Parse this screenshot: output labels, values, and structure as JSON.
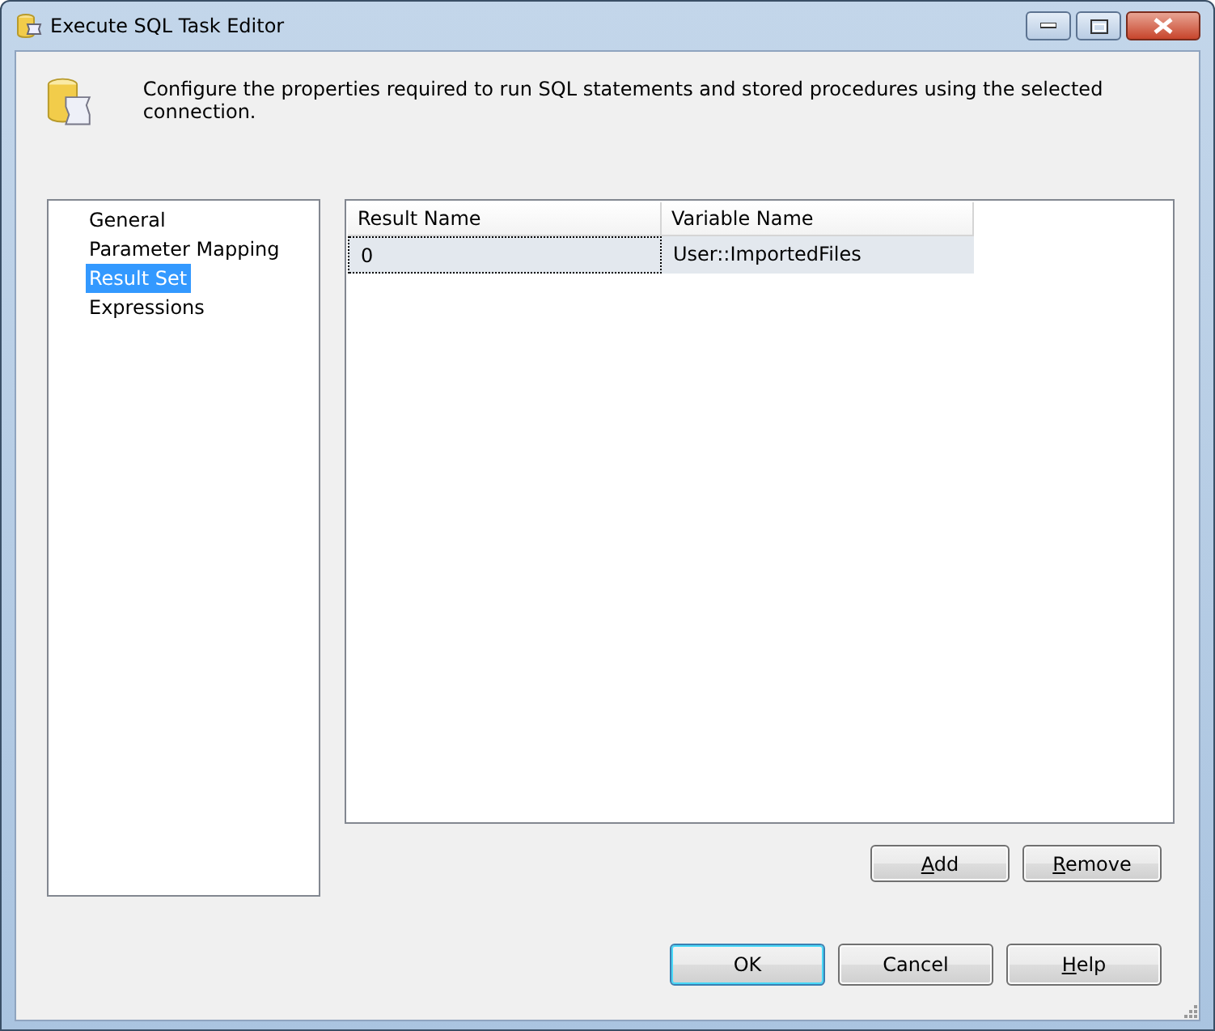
{
  "window": {
    "title": "Execute SQL Task Editor"
  },
  "header": {
    "description": "Configure the properties required to run SQL statements and stored procedures using the selected connection."
  },
  "sidebar": {
    "items": [
      {
        "label": "General",
        "selected": false
      },
      {
        "label": "Parameter Mapping",
        "selected": false
      },
      {
        "label": "Result Set",
        "selected": true
      },
      {
        "label": "Expressions",
        "selected": false
      }
    ]
  },
  "table": {
    "columns": [
      "Result Name",
      "Variable Name"
    ],
    "rows": [
      {
        "cells": [
          "0",
          "User::ImportedFiles"
        ],
        "selected": true
      }
    ]
  },
  "grid_buttons": [
    {
      "label": "Add",
      "access_key": true
    },
    {
      "label": "Remove",
      "access_key": true
    }
  ],
  "dialog_buttons": [
    {
      "label": "OK",
      "access_key": false,
      "default": true
    },
    {
      "label": "Cancel",
      "access_key": false,
      "default": false
    },
    {
      "label": "Help",
      "access_key": true,
      "default": false
    }
  ]
}
